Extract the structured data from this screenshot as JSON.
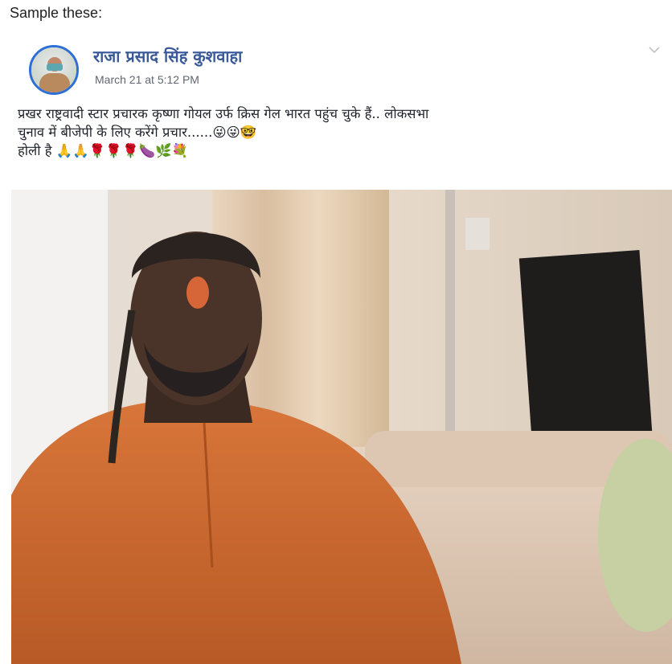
{
  "caption": "Sample these:",
  "post": {
    "author": "राजा प्रसाद सिंह कुशवाहा",
    "timestamp": "March 21 at 5:12 PM",
    "lines": [
      "प्रखर राष्ट्रवादी स्टार प्रचारक कृष्णा गोयल उर्फ क्रिस गेल भारत पहुंच चुके हैं.. लोकसभा",
      "चुनाव में बीजेपी के लिए करेंगे प्रचार......",
      "होली है"
    ],
    "line2_emojis": "😜😜🤓",
    "line3_emojis": "🙏🙏🌹🌹🌹🍆🌿💐",
    "icons": {
      "menu": "chevron-down-icon",
      "avatar": "profile-avatar"
    },
    "colors": {
      "author": "#385898",
      "avatar_ring": "#2d6fd6",
      "timestamp": "#606770"
    }
  }
}
